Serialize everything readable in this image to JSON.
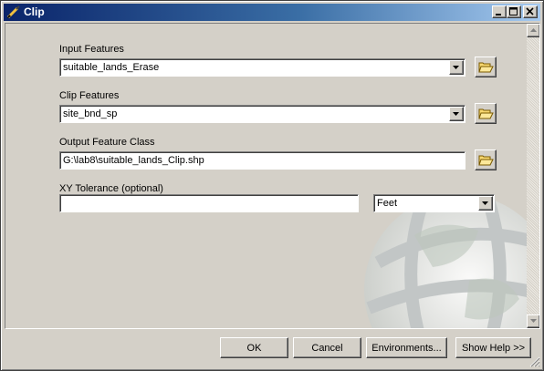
{
  "window": {
    "title": "Clip"
  },
  "title_buttons": [
    "minimize-icon",
    "maximize-icon",
    "close-icon"
  ],
  "form": {
    "input_features": {
      "label": "Input Features",
      "value": "suitable_lands_Erase"
    },
    "clip_features": {
      "label": "Clip Features",
      "value": "site_bnd_sp"
    },
    "output_feature_class": {
      "label": "Output Feature Class",
      "value": "G:\\lab8\\suitable_lands_Clip.shp"
    },
    "xy_tolerance": {
      "label": "XY Tolerance (optional)",
      "value": "",
      "unit": "Feet"
    }
  },
  "buttons": {
    "ok": "OK",
    "cancel": "Cancel",
    "environments": "Environments...",
    "show_help": "Show Help >>"
  },
  "colors": {
    "titlebar_start": "#0a246a",
    "titlebar_end": "#a6caf0",
    "face": "#d4d0c8"
  }
}
